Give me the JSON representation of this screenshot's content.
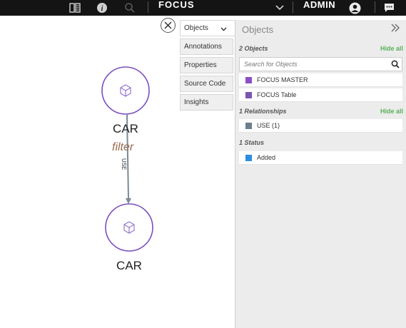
{
  "topbar": {
    "title": "FOCUS",
    "user": "ADMIN",
    "icons": [
      "book-icon",
      "info-icon",
      "search-icon",
      "chevron-down-icon",
      "user-icon",
      "chat-icon"
    ]
  },
  "graph": {
    "nodes": [
      {
        "label": "CAR"
      },
      {
        "label": "CAR"
      }
    ],
    "node_subtitle": "filter",
    "edge_label": "USE"
  },
  "tabs": [
    "Objects",
    "Annotations",
    "Properties",
    "Source Code",
    "Insights"
  ],
  "panel": {
    "title": "Objects",
    "objects": {
      "heading": "2 Objects",
      "hide_all": "Hide all",
      "search_placeholder": "Search for Objects",
      "items": [
        {
          "label": "FOCUS MASTER",
          "color": "#8a4fc8"
        },
        {
          "label": "FOCUS Table",
          "color": "#7a56b0"
        }
      ]
    },
    "relationships": {
      "heading": "1 Relationships",
      "hide_all": "Hide all",
      "items": [
        {
          "label": "USE (1)",
          "color": "#6b7f8c"
        }
      ]
    },
    "status": {
      "heading": "1 Status",
      "items": [
        {
          "label": "Added",
          "color": "#2b8fe0"
        }
      ]
    }
  }
}
